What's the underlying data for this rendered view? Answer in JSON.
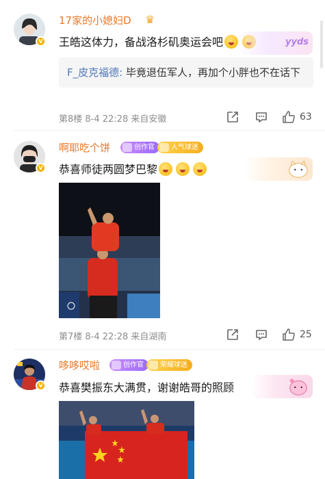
{
  "colors": {
    "username": "#e9782b",
    "reply_user": "#4e78b8",
    "meta": "#8c8c8c",
    "creator_badge": "#9b6cf6",
    "fan_badge": "#f5ad1c"
  },
  "comments": [
    {
      "username": "17家的小媳妇D",
      "text": "王皓这体力，备战洛杉矶奥运会吧",
      "sticker_text": "yyds",
      "reply": {
        "user": "F_皮克福德:",
        "text": " 毕竟退伍军人，再加个小胖也不在话下"
      },
      "meta": "第8楼  8-4 22:28  来自安徽",
      "likes": "63"
    },
    {
      "username": "啊耶吃个饼",
      "badge_creator": "创作官",
      "badge_fan": "人气球迷",
      "text": "恭喜师徒两圆梦巴黎",
      "meta": "第7楼  8-4 22:28  来自湖南",
      "likes": "25"
    },
    {
      "username": "哆哆哎啦",
      "badge_creator": "创作官",
      "badge_fan": "荣耀球迷",
      "text": "恭喜樊振东大满贯，谢谢皓哥的照顾"
    }
  ],
  "icons": {
    "share": "share-icon",
    "comment": "comment-icon",
    "like": "thumbs-up-icon"
  }
}
